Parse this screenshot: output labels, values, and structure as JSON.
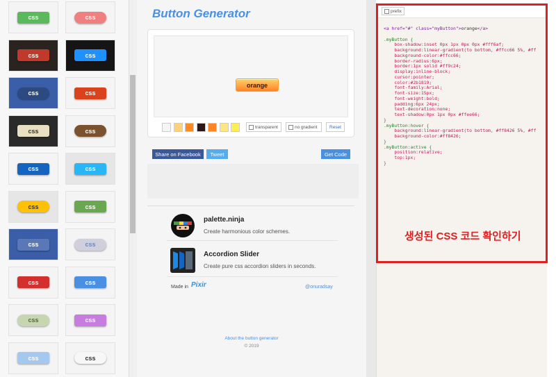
{
  "gallery": {
    "buttons": [
      {
        "label": "css",
        "bg": "#5cb85c",
        "fg": "#ffffff",
        "frame": "#f4f4f4"
      },
      {
        "label": "css",
        "bg": "#f08080",
        "fg": "#ffffff",
        "frame": "#f4f4f4"
      },
      {
        "label": "css",
        "bg": "#c0392b",
        "fg": "#ffffff",
        "frame": "#2a2320"
      },
      {
        "label": "css",
        "bg": "#1e90ff",
        "fg": "#ffffff",
        "frame": "#151515"
      },
      {
        "label": "css",
        "bg": "#2c4a80",
        "fg": "#ffffff",
        "frame": "#3a5ea8"
      },
      {
        "label": "css",
        "bg": "#d9421b",
        "fg": "#ffffff",
        "frame": "#f4f4f4"
      },
      {
        "label": "css",
        "bg": "#e8e0c0",
        "fg": "#333333",
        "frame": "#2a2a2a"
      },
      {
        "label": "css",
        "bg": "#7a5230",
        "fg": "#ffffff",
        "frame": "#f4f4f4"
      },
      {
        "label": "css",
        "bg": "#1565c0",
        "fg": "#ffffff",
        "frame": "#f4f4f4"
      },
      {
        "label": "css",
        "bg": "#29b6f6",
        "fg": "#ffffff",
        "frame": "#e6e6e6"
      },
      {
        "label": "css",
        "bg": "#ffc107",
        "fg": "#333333",
        "frame": "#e6e6e6"
      },
      {
        "label": "css",
        "bg": "#6aa84f",
        "fg": "#ffffff",
        "frame": "#f4f4f4"
      },
      {
        "label": "css",
        "bg": "#5a78b8",
        "fg": "#ffffff",
        "frame": "#3a5ea8"
      },
      {
        "label": "css",
        "bg": "#d0d0dc",
        "fg": "#6a8ab8",
        "frame": "#f4f4f4"
      },
      {
        "label": "css",
        "bg": "#d32f2f",
        "fg": "#ffffff",
        "frame": "#f4f4f4"
      },
      {
        "label": "css",
        "bg": "#4a90e2",
        "fg": "#ffffff",
        "frame": "#f4f4f4"
      },
      {
        "label": "css",
        "bg": "#c5d6b0",
        "fg": "#556644",
        "frame": "#f4f4f4"
      },
      {
        "label": "css",
        "bg": "#c77ddf",
        "fg": "#ffffff",
        "frame": "#f4f4f4"
      },
      {
        "label": "css",
        "bg": "#a5c8f0",
        "fg": "#ffffff",
        "frame": "#f4f4f4"
      },
      {
        "label": "css",
        "bg": "#f7f7f7",
        "fg": "#333333",
        "frame": "#f4f4f4"
      }
    ]
  },
  "generator": {
    "title": "Button Generator",
    "preview_button_label": "orange",
    "swatches": [
      "#f5f5f5",
      "#ffd27a",
      "#ff8a1f",
      "#2b1819",
      "#ff8426",
      "#ffe680",
      "#ffee55"
    ],
    "transparent_label": "transparent",
    "no_gradient_label": "no gradient",
    "reset_label": "Reset",
    "share_facebook_label": "Share on Facebook",
    "tweet_label": "Tweet",
    "get_code_label": "Get Code"
  },
  "promos": [
    {
      "title": "palette.ninja",
      "description": "Create harmonious color schemes."
    },
    {
      "title": "Accordion Slider",
      "description": "Create pure css accordion sliders in seconds."
    }
  ],
  "footer": {
    "made_in": "Made in",
    "made_in_logo": "Pixir",
    "handle": "@onuradsay",
    "about_link": "About the button generator",
    "copyright": "© 2019"
  },
  "code_panel": {
    "prefix_label": "prefix",
    "html_open": "<a href=\"#\" class=\"myButton\">",
    "html_text": "orange",
    "html_close": "</a>",
    "rules": [
      {
        "selector": ".myButton {",
        "props": [
          "box-shadow:inset 0px 1px 0px 0px #fff6af;",
          "background:linear-gradient(to bottom, #ffcc66 5%, #ff",
          "background-color:#ffcc66;",
          "border-radius:6px;",
          "border:1px solid #ff9c24;",
          "display:inline-block;",
          "cursor:pointer;",
          "color:#2b1819;",
          "font-family:Arial;",
          "font-size:15px;",
          "font-weight:bold;",
          "padding:6px 24px;",
          "text-decoration:none;",
          "text-shadow:0px 1px 0px #ffee66;"
        ]
      },
      {
        "selector": ".myButton:hover {",
        "props": [
          "background:linear-gradient(to bottom, #ff8426 5%, #ff",
          "background-color:#ff8426;"
        ]
      },
      {
        "selector": ".myButton:active {",
        "props": [
          "position:relative;",
          "top:1px;"
        ]
      }
    ],
    "close_brace": "}"
  },
  "annotation": "생성된 CSS 코드 확인하기",
  "colors": {
    "accent": "#4a90e2",
    "annotation_red": "#e02020",
    "facebook": "#3b5998",
    "twitter": "#55acee"
  }
}
